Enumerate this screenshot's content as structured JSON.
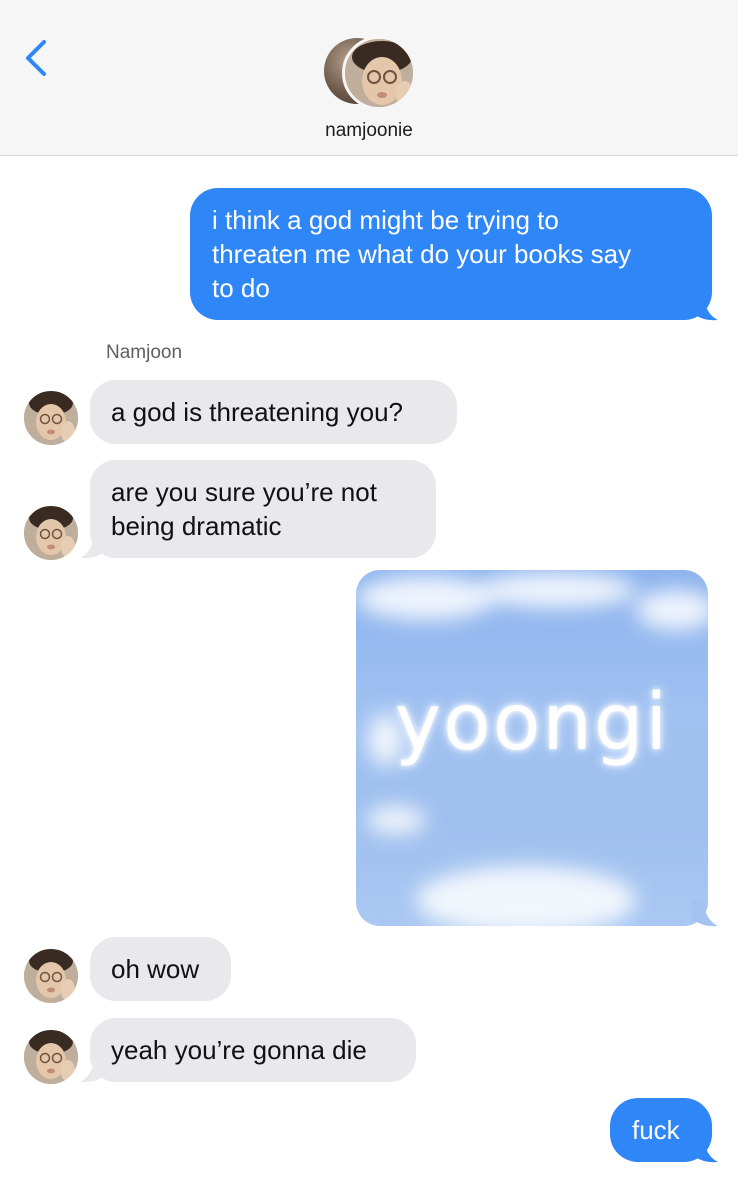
{
  "header": {
    "contact_name": "namjoonie",
    "back_icon": "chevron-left-icon"
  },
  "messages": [
    {
      "from": "me",
      "text_lines": [
        "i think a god might be trying to",
        "threaten me what do your books say",
        "to do"
      ]
    },
    {
      "from": "Namjoon",
      "sender_label": "Namjoon",
      "text": "a god is threatening you?"
    },
    {
      "from": "Namjoon",
      "text_lines": [
        "are you sure you’re not",
        "being dramatic"
      ]
    },
    {
      "from": "me",
      "image": {
        "caption_text": "yoongi"
      }
    },
    {
      "from": "Namjoon",
      "text": "oh wow"
    },
    {
      "from": "Namjoon",
      "text": "yeah you’re gonna die"
    },
    {
      "from": "me",
      "text": "fuck"
    }
  ],
  "colors": {
    "sent": "#2f86f6",
    "received": "#e8e8ed",
    "accent": "#2f86f6"
  }
}
